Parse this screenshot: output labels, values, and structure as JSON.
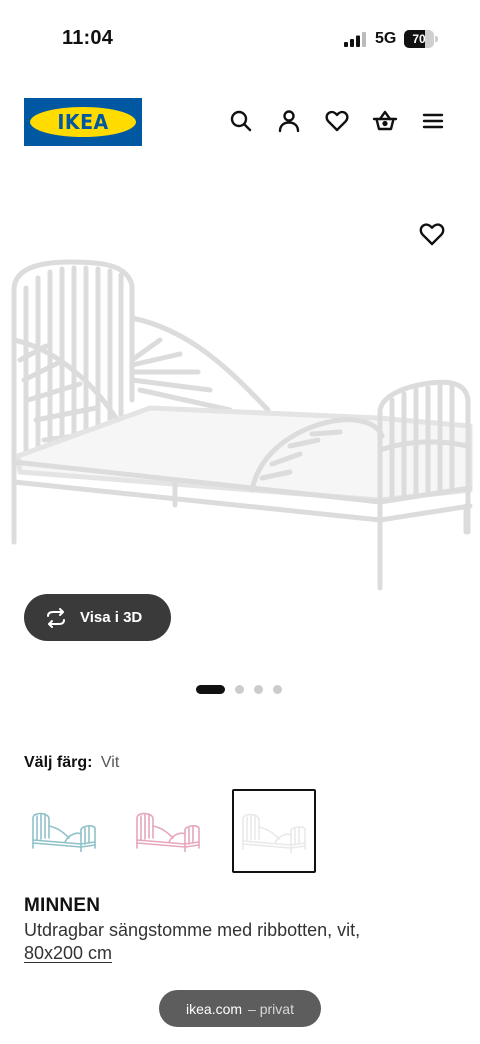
{
  "status_bar": {
    "time": "11:04",
    "network": "5G",
    "battery_level": "70",
    "battery_fraction": 0.7
  },
  "header": {
    "logo_text": "IKEA",
    "brand_colors": {
      "blue": "#0058a3",
      "yellow": "#ffdb00"
    },
    "icons": [
      "search-icon",
      "account-icon",
      "heart-icon",
      "basket-icon",
      "menu-icon"
    ]
  },
  "gallery": {
    "favorite_icon": "heart-icon",
    "view_3d_label": "Visa i 3D",
    "view_3d_icon": "rotate-icon",
    "page_count": 4,
    "active_page": 1
  },
  "color_picker": {
    "label": "Välj färg:",
    "selected_value": "Vit",
    "swatches": [
      {
        "color": "#8fc1c9",
        "selected": false
      },
      {
        "color": "#e6a6bd",
        "selected": false
      },
      {
        "color": "#e9e9e9",
        "selected": true
      }
    ]
  },
  "product": {
    "name": "MINNEN",
    "description": "Utdragbar sängstomme med ribbotten, vit,",
    "size": "80x200 cm"
  },
  "browser": {
    "domain": "ikea.com",
    "mode": "– privat"
  }
}
